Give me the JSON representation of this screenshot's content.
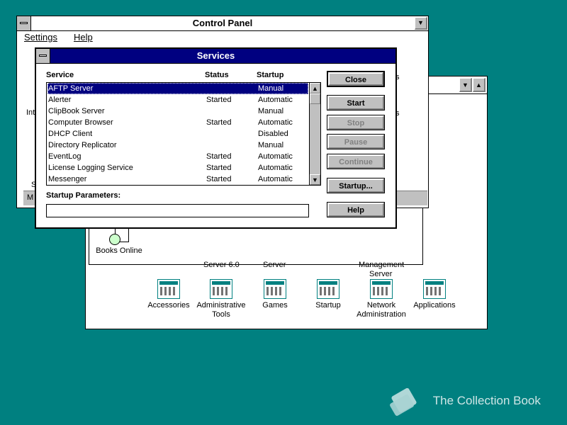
{
  "control_panel": {
    "title": "Control Panel",
    "menu": [
      "Settings",
      "Help"
    ],
    "partial_labels": {
      "left1": "Int",
      "left2": "S",
      "left3": "M",
      "right1": "s",
      "right2": "s"
    }
  },
  "program_group": {
    "partial_labels": [
      "Server 6.0",
      "Server",
      "Management",
      "Server"
    ],
    "books_online": "Books Online",
    "icons": [
      {
        "label": [
          "Accessories"
        ],
        "icon": "program-group-icon"
      },
      {
        "label": [
          "Administrative",
          "Tools"
        ],
        "icon": "program-group-icon"
      },
      {
        "label": [
          "Games"
        ],
        "icon": "program-group-icon"
      },
      {
        "label": [
          "Startup"
        ],
        "icon": "program-group-icon"
      },
      {
        "label": [
          "Network",
          "Administration"
        ],
        "icon": "program-group-icon"
      },
      {
        "label": [
          "Applications"
        ],
        "icon": "program-group-icon"
      }
    ]
  },
  "services": {
    "title": "Services",
    "columns": {
      "service": "Service",
      "status": "Status",
      "startup": "Startup"
    },
    "rows": [
      {
        "service": "AFTP Server",
        "status": "",
        "startup": "Manual",
        "selected": true
      },
      {
        "service": "Alerter",
        "status": "Started",
        "startup": "Automatic"
      },
      {
        "service": "ClipBook Server",
        "status": "",
        "startup": "Manual"
      },
      {
        "service": "Computer Browser",
        "status": "Started",
        "startup": "Automatic"
      },
      {
        "service": "DHCP Client",
        "status": "",
        "startup": "Disabled"
      },
      {
        "service": "Directory Replicator",
        "status": "",
        "startup": "Manual"
      },
      {
        "service": "EventLog",
        "status": "Started",
        "startup": "Automatic"
      },
      {
        "service": "License Logging Service",
        "status": "Started",
        "startup": "Automatic"
      },
      {
        "service": "Messenger",
        "status": "Started",
        "startup": "Automatic"
      }
    ],
    "startup_parameters_label": "Startup Parameters:",
    "startup_parameters_value": "",
    "buttons": {
      "close": "Close",
      "start": "Start",
      "stop": "Stop",
      "pause": "Pause",
      "continue": "Continue",
      "startup": "Startup...",
      "help": "Help"
    }
  },
  "watermark": "The Collection Book"
}
